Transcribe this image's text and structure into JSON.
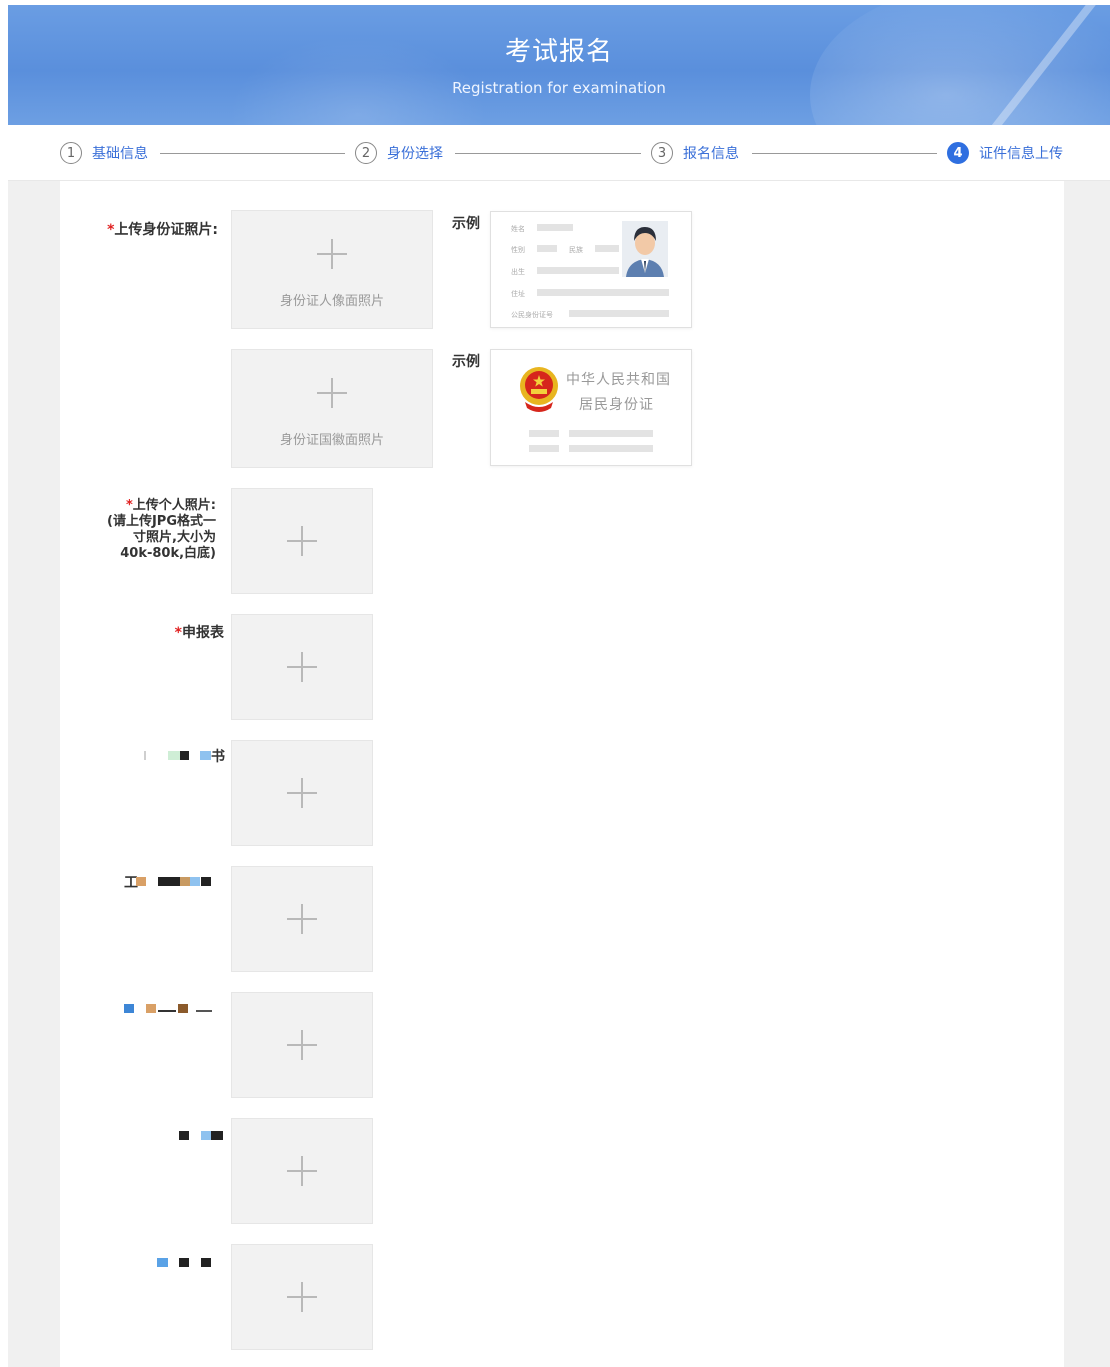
{
  "header": {
    "title": "考试报名",
    "subtitle": "Registration for examination"
  },
  "steps": [
    {
      "num": "1",
      "label": "基础信息",
      "active": false
    },
    {
      "num": "2",
      "label": "身份选择",
      "active": false
    },
    {
      "num": "3",
      "label": "报名信息",
      "active": false
    },
    {
      "num": "4",
      "label": "证件信息上传",
      "active": true
    }
  ],
  "form": {
    "id_card": {
      "required_mark": "*",
      "label": "上传身份证照片:",
      "front_hint": "身份证人像面照片",
      "back_hint": "身份证国徽面照片",
      "example_label": "示例",
      "example_front_fields": [
        "姓名",
        "性别",
        "民族",
        "出生",
        "住址",
        "公民身份证号"
      ],
      "example_back_line1": "中华人民共和国",
      "example_back_line2": "居民身份证"
    },
    "photo": {
      "required_mark": "*",
      "label": "上传个人照片:",
      "note_line1": "(请上传JPG格式一",
      "note_line2": "寸照片,大小为",
      "note_line3": "40k-80k,白底)"
    },
    "application": {
      "required_mark": "*",
      "label": "申报表"
    },
    "field4": {
      "label_tail": "书"
    },
    "field5": {
      "label_head": "工"
    }
  },
  "colors": {
    "primary": "#2f6fe0",
    "required": "#e02020",
    "banner": "#5a8fdc"
  }
}
